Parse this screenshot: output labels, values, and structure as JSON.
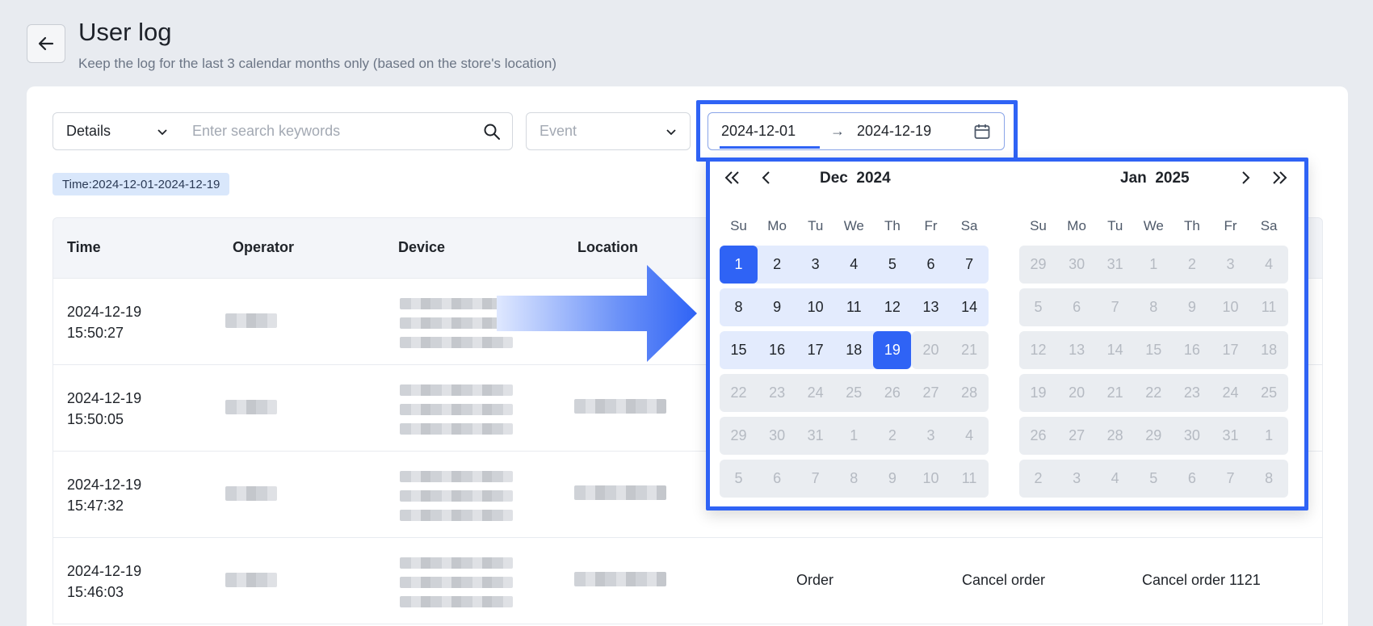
{
  "header": {
    "title": "User log",
    "subtitle": "Keep the log for the last 3 calendar months only (based on the store's location)"
  },
  "filters": {
    "type_value": "Details",
    "search_placeholder": "Enter search keywords",
    "event_placeholder": "Event",
    "range_start": "2024-12-01",
    "range_separator": "→",
    "range_end": "2024-12-19",
    "tag": "Time:2024-12-01-2024-12-19"
  },
  "table": {
    "columns": [
      "Time",
      "Operator",
      "Device",
      "Location"
    ],
    "rows": [
      {
        "date": "2024-12-19",
        "time": "15:50:27"
      },
      {
        "date": "2024-12-19",
        "time": "15:50:05"
      },
      {
        "date": "2024-12-19",
        "time": "15:47:32"
      },
      {
        "date": "2024-12-19",
        "time": "15:46:03",
        "module": "Order",
        "event": "Cancel order",
        "details": "Cancel order 1121"
      }
    ]
  },
  "calendar": {
    "weekdays": [
      "Su",
      "Mo",
      "Tu",
      "We",
      "Th",
      "Fr",
      "Sa"
    ],
    "left": {
      "month": "Dec",
      "year": "2024",
      "weeks": [
        [
          "1",
          "2",
          "3",
          "4",
          "5",
          "6",
          "7"
        ],
        [
          "8",
          "9",
          "10",
          "11",
          "12",
          "13",
          "14"
        ],
        [
          "15",
          "16",
          "17",
          "18",
          "19",
          "20",
          "21"
        ],
        [
          "22",
          "23",
          "24",
          "25",
          "26",
          "27",
          "28"
        ],
        [
          "29",
          "30",
          "31",
          "1",
          "2",
          "3",
          "4"
        ],
        [
          "5",
          "6",
          "7",
          "8",
          "9",
          "10",
          "11"
        ]
      ]
    },
    "right": {
      "month": "Jan",
      "year": "2025",
      "weeks": [
        [
          "29",
          "30",
          "31",
          "1",
          "2",
          "3",
          "4"
        ],
        [
          "5",
          "6",
          "7",
          "8",
          "9",
          "10",
          "11"
        ],
        [
          "12",
          "13",
          "14",
          "15",
          "16",
          "17",
          "18"
        ],
        [
          "19",
          "20",
          "21",
          "22",
          "23",
          "24",
          "25"
        ],
        [
          "26",
          "27",
          "28",
          "29",
          "30",
          "31",
          "1"
        ],
        [
          "2",
          "3",
          "4",
          "5",
          "6",
          "7",
          "8"
        ]
      ]
    },
    "range_start_day": "1",
    "range_end_day": "19"
  },
  "colors": {
    "accent": "#2f63f5",
    "in_range": "#e3ebfd",
    "disabled": "#eaedf1"
  }
}
